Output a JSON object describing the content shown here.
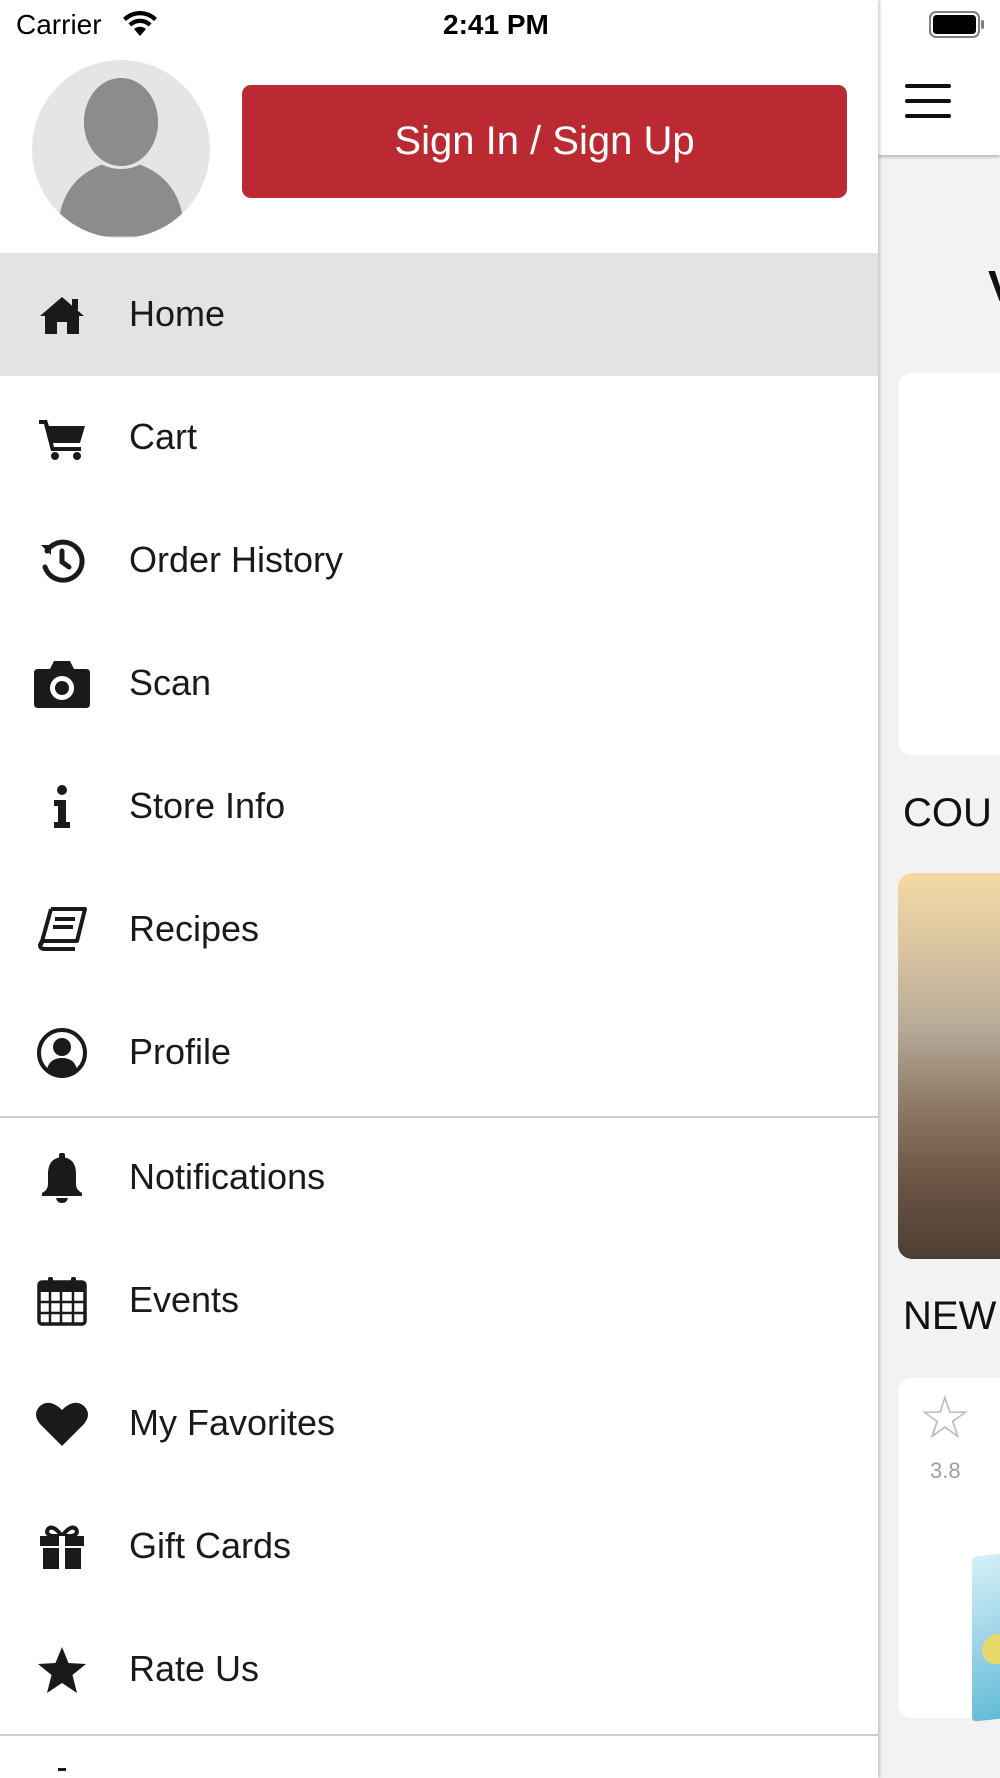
{
  "status_bar": {
    "carrier": "Carrier",
    "time": "2:41 PM"
  },
  "drawer": {
    "sign_in_label": "Sign In / Sign Up",
    "active_item": "Home",
    "items": [
      {
        "label": "Home",
        "icon": "home-icon"
      },
      {
        "label": "Cart",
        "icon": "cart-icon"
      },
      {
        "label": "Order History",
        "icon": "history-icon"
      },
      {
        "label": "Scan",
        "icon": "camera-icon"
      },
      {
        "label": "Store Info",
        "icon": "info-icon"
      },
      {
        "label": "Recipes",
        "icon": "book-icon"
      },
      {
        "label": "Profile",
        "icon": "user-circle-icon"
      },
      {
        "label": "Notifications",
        "icon": "bell-icon"
      },
      {
        "label": "Events",
        "icon": "calendar-icon"
      },
      {
        "label": "My Favorites",
        "icon": "heart-icon"
      },
      {
        "label": "Gift Cards",
        "icon": "gift-icon"
      },
      {
        "label": "Rate Us",
        "icon": "star-icon"
      }
    ]
  },
  "background_page": {
    "section_coupons": "COU",
    "section_new": "NEW",
    "card_text": "W",
    "product_rating": "3.8"
  },
  "colors": {
    "accent": "#bb2a33",
    "active_row": "#e3e3e3",
    "icon": "#1a1a1a"
  }
}
